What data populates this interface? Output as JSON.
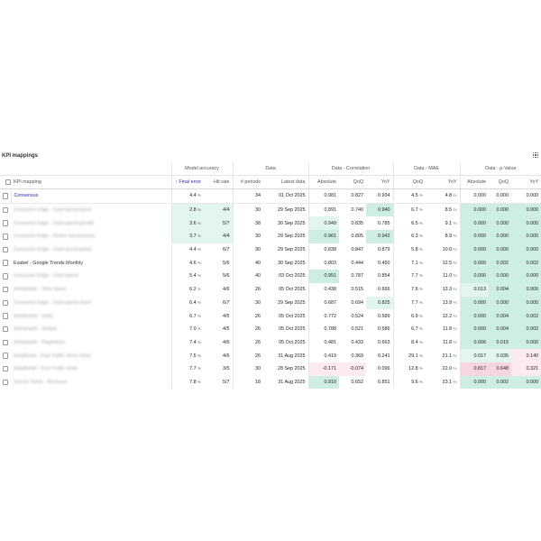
{
  "panel": {
    "title": "KPI mappings"
  },
  "groups": {
    "model_accuracy": "Model accuracy",
    "data": "Data",
    "correlation": "Data - Correlation",
    "mae": "Data - MAE",
    "pvalue": "Data - p-Value"
  },
  "columns": {
    "kpi": "KPI mapping",
    "final_error": "↑ Final error",
    "hit_rate": "Hit rate",
    "periods": "# periods",
    "latest": "Latest data",
    "corr_abs": "Absolute",
    "corr_qoq": "QoQ",
    "corr_yoy": "YoY",
    "mae_qoq": "QoQ",
    "mae_yoy": "YoY",
    "p_abs": "Absolute",
    "p_qoq": "QoQ",
    "p_yoy": "YoY"
  },
  "rows": [
    {
      "name": "Consensus",
      "blur": false,
      "link": true,
      "fe": "4.4",
      "hr": "",
      "periods": "34",
      "latest": "01 Oct 2025",
      "ca": "0.981",
      "cq": "0.827",
      "cy": "0.934",
      "mq": "4.5",
      "my": "4.8",
      "pa": "0.000",
      "pq": "0.000",
      "py": "0.000"
    },
    {
      "name": "Consumer Edge - Card spend panel",
      "blur": true,
      "link": false,
      "fe": "2.8",
      "hr": "4/4",
      "periods": "30",
      "latest": "29 Sep 2025",
      "ca": "0.891",
      "cq": "0.740",
      "cy": "0.940",
      "mq": "6.7",
      "my": "8.5",
      "pa": "0.000",
      "pq": "0.000",
      "py": "0.000"
    },
    {
      "name": "Consumer Edge - Card spend growth",
      "blur": true,
      "link": false,
      "fe": "3.6",
      "hr": "5/7",
      "periods": "38",
      "latest": "30 Sep 2025",
      "ca": "0.949",
      "cq": "0.835",
      "cy": "0.785",
      "mq": "6.5",
      "my": "9.1",
      "pa": "0.000",
      "pq": "0.000",
      "py": "0.000"
    },
    {
      "name": "Consumer Edge - Online transactions",
      "blur": true,
      "link": false,
      "fe": "3.7",
      "hr": "4/4",
      "periods": "30",
      "latest": "29 Sep 2025",
      "ca": "0.961",
      "cq": "0.805",
      "cy": "0.942",
      "mq": "6.3",
      "my": "8.9",
      "pa": "0.000",
      "pq": "0.000",
      "py": "0.000"
    },
    {
      "name": "Consumer Edge - Card spend panel",
      "blur": true,
      "link": false,
      "fe": "4.4",
      "hr": "6/7",
      "periods": "30",
      "latest": "29 Sep 2025",
      "ca": "0.838",
      "cq": "0.847",
      "cy": "0.879",
      "mq": "5.8",
      "my": "10.0",
      "pa": "0.000",
      "pq": "0.000",
      "py": "0.000"
    },
    {
      "name": "Exabel - Google Trends Monthly",
      "blur": false,
      "link": false,
      "fe": "4.6",
      "hr": "5/6",
      "periods": "40",
      "latest": "30 Sep 2025",
      "ca": "0.803",
      "cq": "0.444",
      "cy": "0.450",
      "mq": "7.1",
      "my": "12.5",
      "pa": "0.000",
      "pq": "0.002",
      "py": "0.002"
    },
    {
      "name": "Consumer Edge - Card spend",
      "blur": true,
      "link": false,
      "fe": "5.4",
      "hr": "5/6",
      "periods": "40",
      "latest": "03 Oct 2025",
      "ca": "0.951",
      "cq": "0.787",
      "cy": "0.854",
      "mq": "7.7",
      "my": "11.0",
      "pa": "0.000",
      "pq": "0.000",
      "py": "0.000"
    },
    {
      "name": "Similarweb - Time Spent",
      "blur": true,
      "link": false,
      "fe": "6.2",
      "hr": "4/6",
      "periods": "26",
      "latest": "05 Oct 2025",
      "ca": "0.438",
      "cq": "0.515",
      "cy": "0.666",
      "mq": "7.6",
      "my": "13.3",
      "pa": "0.013",
      "pq": "0.004",
      "py": "0.000"
    },
    {
      "name": "Consumer Edge - Card spend share",
      "blur": true,
      "link": false,
      "fe": "6.4",
      "hr": "6/7",
      "periods": "30",
      "latest": "29 Sep 2025",
      "ca": "0.687",
      "cq": "0.694",
      "cy": "0.825",
      "mq": "7.7",
      "my": "13.9",
      "pa": "0.000",
      "pq": "0.000",
      "py": "0.000"
    },
    {
      "name": "Similarweb - Visits",
      "blur": true,
      "link": false,
      "fe": "6.7",
      "hr": "4/5",
      "periods": "26",
      "latest": "05 Oct 2025",
      "ca": "0.772",
      "cq": "0.524",
      "cy": "0.589",
      "mq": "6.9",
      "my": "12.2",
      "pa": "0.000",
      "pq": "0.004",
      "py": "0.002"
    },
    {
      "name": "Similarweb - Unique",
      "blur": true,
      "link": false,
      "fe": "7.0",
      "hr": "4/5",
      "periods": "26",
      "latest": "05 Oct 2025",
      "ca": "0.788",
      "cq": "0.521",
      "cy": "0.586",
      "mq": "6.7",
      "my": "11.8",
      "pa": "0.000",
      "pq": "0.004",
      "py": "0.002"
    },
    {
      "name": "Similarweb - Pageviews",
      "blur": true,
      "link": false,
      "fe": "7.4",
      "hr": "4/6",
      "periods": "26",
      "latest": "05 Oct 2025",
      "ca": "0.481",
      "cq": "0.433",
      "cy": "0.663",
      "mq": "8.4",
      "my": "11.8",
      "pa": "0.006",
      "pq": "0.015",
      "py": "0.000"
    },
    {
      "name": "DataRetail - Foot Traffic Store Visits",
      "blur": true,
      "link": false,
      "fe": "7.5",
      "hr": "4/6",
      "periods": "26",
      "latest": "31 Aug 2025",
      "ca": "0.419",
      "cq": "0.369",
      "cy": "0.241",
      "mq": "29.1",
      "my": "21.1",
      "pa": "0.017",
      "pq": "0.035",
      "py": "0.140"
    },
    {
      "name": "DataRetail - Foot Traffic Visits",
      "blur": true,
      "link": false,
      "fe": "7.7",
      "hr": "3/5",
      "periods": "30",
      "latest": "28 Sep 2025",
      "ca": "-0.171",
      "cq": "-0.074",
      "cy": "0.096",
      "mq": "12.8",
      "my": "22.0",
      "pa": "0.817",
      "pq": "0.648",
      "py": "0.321"
    },
    {
      "name": "Sensor Tower - Revenue",
      "blur": true,
      "link": false,
      "fe": "7.8",
      "hr": "5/7",
      "periods": "18",
      "latest": "31 Aug 2025",
      "ca": "0.910",
      "cq": "0.652",
      "cy": "0.851",
      "mq": "9.6",
      "my": "23.1",
      "pa": "0.000",
      "pq": "0.002",
      "py": "0.000"
    }
  ],
  "highlights": [
    [
      "",
      "",
      "",
      "",
      "",
      "",
      "",
      "",
      "",
      ""
    ],
    [
      "g1",
      "g1",
      "",
      "",
      "",
      "g2",
      "",
      "g2",
      "g2",
      "g2"
    ],
    [
      "g1",
      "g1",
      "",
      "g1",
      "",
      "",
      "",
      "g2",
      "g2",
      "g2"
    ],
    [
      "g1",
      "g1",
      "",
      "g2",
      "",
      "g2",
      "",
      "g2",
      "g2",
      "g2"
    ],
    [
      "",
      "",
      "",
      "",
      "",
      "",
      "",
      "g2",
      "g2",
      "g2"
    ],
    [
      "",
      "",
      "",
      "",
      "",
      "",
      "",
      "g2",
      "g2",
      "g2"
    ],
    [
      "",
      "",
      "",
      "g2",
      "",
      "",
      "",
      "g2",
      "g2",
      "g2"
    ],
    [
      "",
      "",
      "",
      "",
      "",
      "",
      "",
      "g1",
      "g2",
      "g2"
    ],
    [
      "",
      "",
      "",
      "",
      "",
      "g1",
      "",
      "g2",
      "g2",
      "g2"
    ],
    [
      "",
      "",
      "",
      "",
      "",
      "",
      "",
      "g2",
      "g2",
      "g2"
    ],
    [
      "",
      "",
      "",
      "",
      "",
      "",
      "",
      "g2",
      "g2",
      "g2"
    ],
    [
      "",
      "",
      "",
      "",
      "",
      "",
      "",
      "g2",
      "g2",
      "g2"
    ],
    [
      "",
      "",
      "",
      "",
      "",
      "",
      "",
      "g1",
      "g1",
      "r1"
    ],
    [
      "",
      "",
      "",
      "r1",
      "r1",
      "",
      "",
      "r2",
      "r2",
      "r1"
    ],
    [
      "",
      "",
      "",
      "g2",
      "",
      "",
      "",
      "g2",
      "g2",
      "g2"
    ]
  ],
  "colors": {
    "accent": "#2b2bb5",
    "good_light": "#e3f5ef",
    "good": "#cfeee2",
    "bad_light": "#fbeaef",
    "bad": "#f7d6e0"
  }
}
